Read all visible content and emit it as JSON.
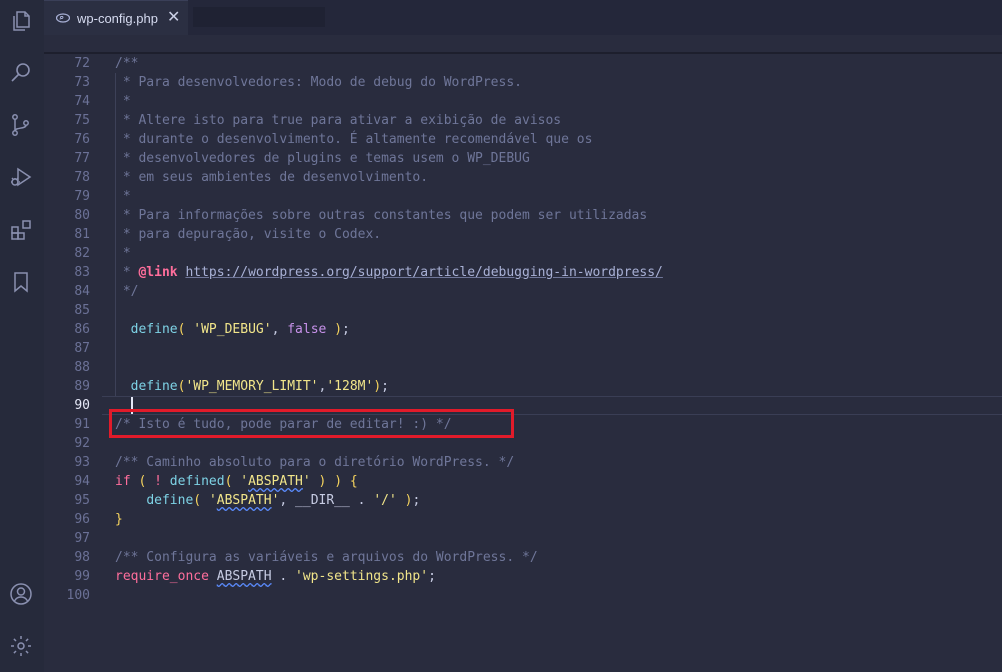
{
  "colors": {
    "background": "#292c3e",
    "activity_bar": "#262a3b",
    "comment": "#6f7699",
    "keyword": "#ff6e9c",
    "function": "#7ed3e6",
    "string": "#f1e58a",
    "paren": "#f6d45e",
    "boolean": "#c792ea",
    "highlight_box": "#e11b2a"
  },
  "activity_bar": {
    "icons": [
      "explorer-icon",
      "search-icon",
      "source-control-icon",
      "run-debug-icon",
      "extensions-icon",
      "bookmark-icon",
      "account-icon",
      "settings-gear-icon"
    ]
  },
  "tabs": [
    {
      "label": "wp-config.php",
      "icon": "php-file-icon",
      "close": "✕",
      "active": true
    }
  ],
  "editor": {
    "active_line": "90",
    "line_numbers": [
      "72",
      "73",
      "74",
      "75",
      "76",
      "77",
      "78",
      "79",
      "80",
      "81",
      "82",
      "83",
      "84",
      "85",
      "86",
      "87",
      "88",
      "89",
      "90",
      "91",
      "92",
      "93",
      "94",
      "95",
      "96",
      "97",
      "98",
      "99",
      "100"
    ],
    "lines": {
      "l72": "/**",
      "l73": " * Para desenvolvedores: Modo de debug do WordPress.",
      "l74": " *",
      "l75": " * Altere isto para true para ativar a exibição de avisos",
      "l76": " * durante o desenvolvimento. É altamente recomendável que os",
      "l77": " * desenvolvedores de plugins e temas usem o WP_DEBUG",
      "l78": " * em seus ambientes de desenvolvimento.",
      "l79": " *",
      "l80": " * Para informações sobre outras constantes que podem ser utilizadas",
      "l81": " * para depuração, visite o Codex.",
      "l82": " *",
      "l83_prefix": " * ",
      "l83_tag": "@link",
      "l83_space": " ",
      "l83_url": "https://wordpress.org/support/article/debugging-in-wordpress/",
      "l84": " */",
      "l86": {
        "indent": "  ",
        "fn": "define",
        "open": "(",
        "sp1": " ",
        "str": "'WP_DEBUG'",
        "comma": ", ",
        "bool": "false",
        "sp2": " ",
        "close": ")",
        "semi": ";"
      },
      "l89": {
        "indent": "  ",
        "fn": "define",
        "open": "(",
        "str1": "'WP_MEMORY_LIMIT'",
        "comma": ",",
        "str2": "'128M'",
        "close": ")",
        "semi": ";"
      },
      "l91": "/* Isto é tudo, pode parar de editar! :) */",
      "l93": "/** Caminho absoluto para o diretório WordPress. */",
      "l94": {
        "kw": "if",
        "sp1": " ",
        "open1": "(",
        "sp2": " ",
        "not": "!",
        "sp3": " ",
        "fn": "defined",
        "open2": "(",
        "sp4": " ",
        "str_q1": "'",
        "str_body": "ABSPATH",
        "str_q2": "'",
        "sp5": " ",
        "close2": ")",
        "sp6": " ",
        "close1": ")",
        "sp7": " ",
        "brace": "{"
      },
      "l95": {
        "indent": "    ",
        "fn": "define",
        "open": "(",
        "sp1": " ",
        "str_q1": "'",
        "str_body": "ABSPATH",
        "str_q2": "'",
        "comma": ", ",
        "dir": "__DIR__",
        "dot": " . ",
        "slash": "'/'",
        "sp2": " ",
        "close": ")",
        "semi": ";"
      },
      "l96": "}",
      "l98": "/** Configura as variáveis e arquivos do WordPress. */",
      "l99": {
        "kw": "require_once",
        "sp1": " ",
        "const": "ABSPATH",
        "dot": " . ",
        "str": "'wp-settings.php'",
        "semi": ";"
      }
    }
  }
}
